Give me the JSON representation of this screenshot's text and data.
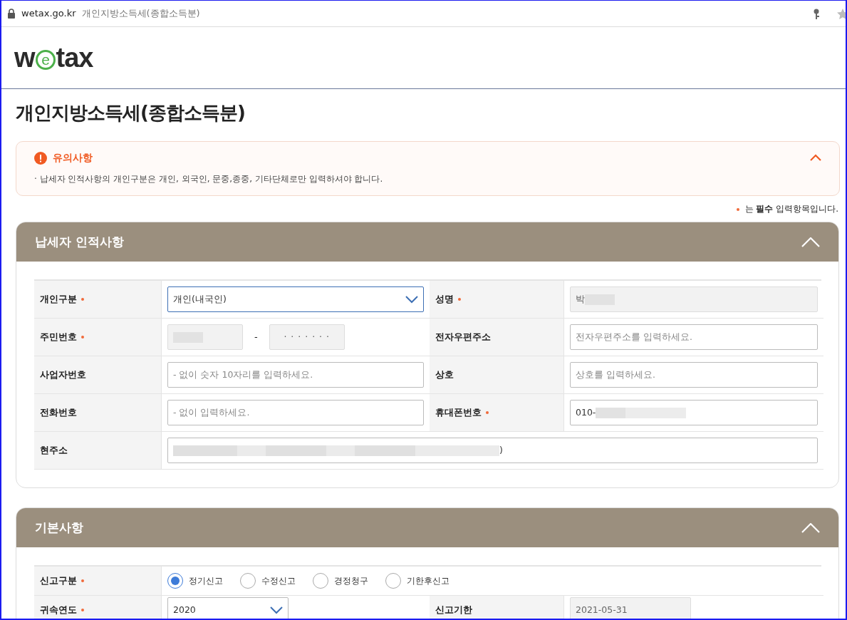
{
  "browser": {
    "domain": "wetax.go.kr",
    "page_title": "개인지방소득세(종합소득분)"
  },
  "logo": {
    "text": "wetax"
  },
  "page_title": "개인지방소득세(종합소득분)",
  "notice": {
    "title": "유의사항",
    "expanded": true,
    "items": [
      "· 납세자 인적사항의 개인구분은 개인, 외국인, 문중,종중, 기타단체로만 입력하셔야 합니다."
    ]
  },
  "required_note": "는 **필수** 입력항목입니다.",
  "sections": [
    {
      "title": "납세자 인적사항",
      "expanded": true,
      "rows": [
        {
          "cells": [
            {
              "label": "개인구분",
              "required": true,
              "field": {
                "kind": "select",
                "value": "개인(내국인)",
                "focused": true
              }
            },
            {
              "label": "성명",
              "required": true,
              "field": {
                "kind": "text",
                "value": "박",
                "redacted": true,
                "disabled": true
              }
            }
          ]
        },
        {
          "cells": [
            {
              "label": "주민번호",
              "required": true,
              "field": {
                "kind": "rrn",
                "separator": "-",
                "value": "· · · · · · ·",
                "redacted": true,
                "disabled": true
              }
            },
            {
              "label": "전자우편주소",
              "required": false,
              "field": {
                "kind": "text",
                "placeholder": "전자우편주소를 입력하세요.",
                "disabled": false
              }
            }
          ]
        },
        {
          "cells": [
            {
              "label": "사업자번호",
              "required": false,
              "field": {
                "kind": "text",
                "placeholder": "- 없이 숫자 10자리를 입력하세요.",
                "disabled": false
              }
            },
            {
              "label": "상호",
              "required": false,
              "field": {
                "kind": "text",
                "placeholder": "상호를 입력하세요.",
                "disabled": false
              }
            }
          ]
        },
        {
          "cells": [
            {
              "label": "전화번호",
              "required": false,
              "field": {
                "kind": "text",
                "placeholder": "- 없이 입력하세요.",
                "disabled": false
              }
            },
            {
              "label": "휴대폰번호",
              "required": true,
              "field": {
                "kind": "text",
                "value": "010-",
                "redacted": true,
                "disabled": false
              }
            }
          ]
        },
        {
          "cells": [
            {
              "label": "현주소",
              "required": false,
              "field": {
                "kind": "address",
                "suffix": ")",
                "redacted": true,
                "disabled": false
              }
            }
          ]
        }
      ]
    },
    {
      "title": "기본사항",
      "expanded": true,
      "rows": [
        {
          "cells": [
            {
              "label": "신고구분",
              "required": true,
              "field": {
                "kind": "radio",
                "options": [
                  {
                    "label": "정기신고",
                    "selected": true
                  },
                  {
                    "label": "수정신고",
                    "selected": false
                  },
                  {
                    "label": "경정청구",
                    "selected": false
                  },
                  {
                    "label": "기한후신고",
                    "selected": false
                  }
                ]
              }
            }
          ]
        },
        {
          "cells": [
            {
              "label": "귀속연도",
              "required": true,
              "field": {
                "kind": "select",
                "value": "2020",
                "focused": false,
                "short": true
              }
            },
            {
              "label": "신고기한",
              "required": false,
              "field": {
                "kind": "text",
                "value": "2021-05-31",
                "disabled": true,
                "short": true
              }
            }
          ]
        }
      ]
    }
  ]
}
